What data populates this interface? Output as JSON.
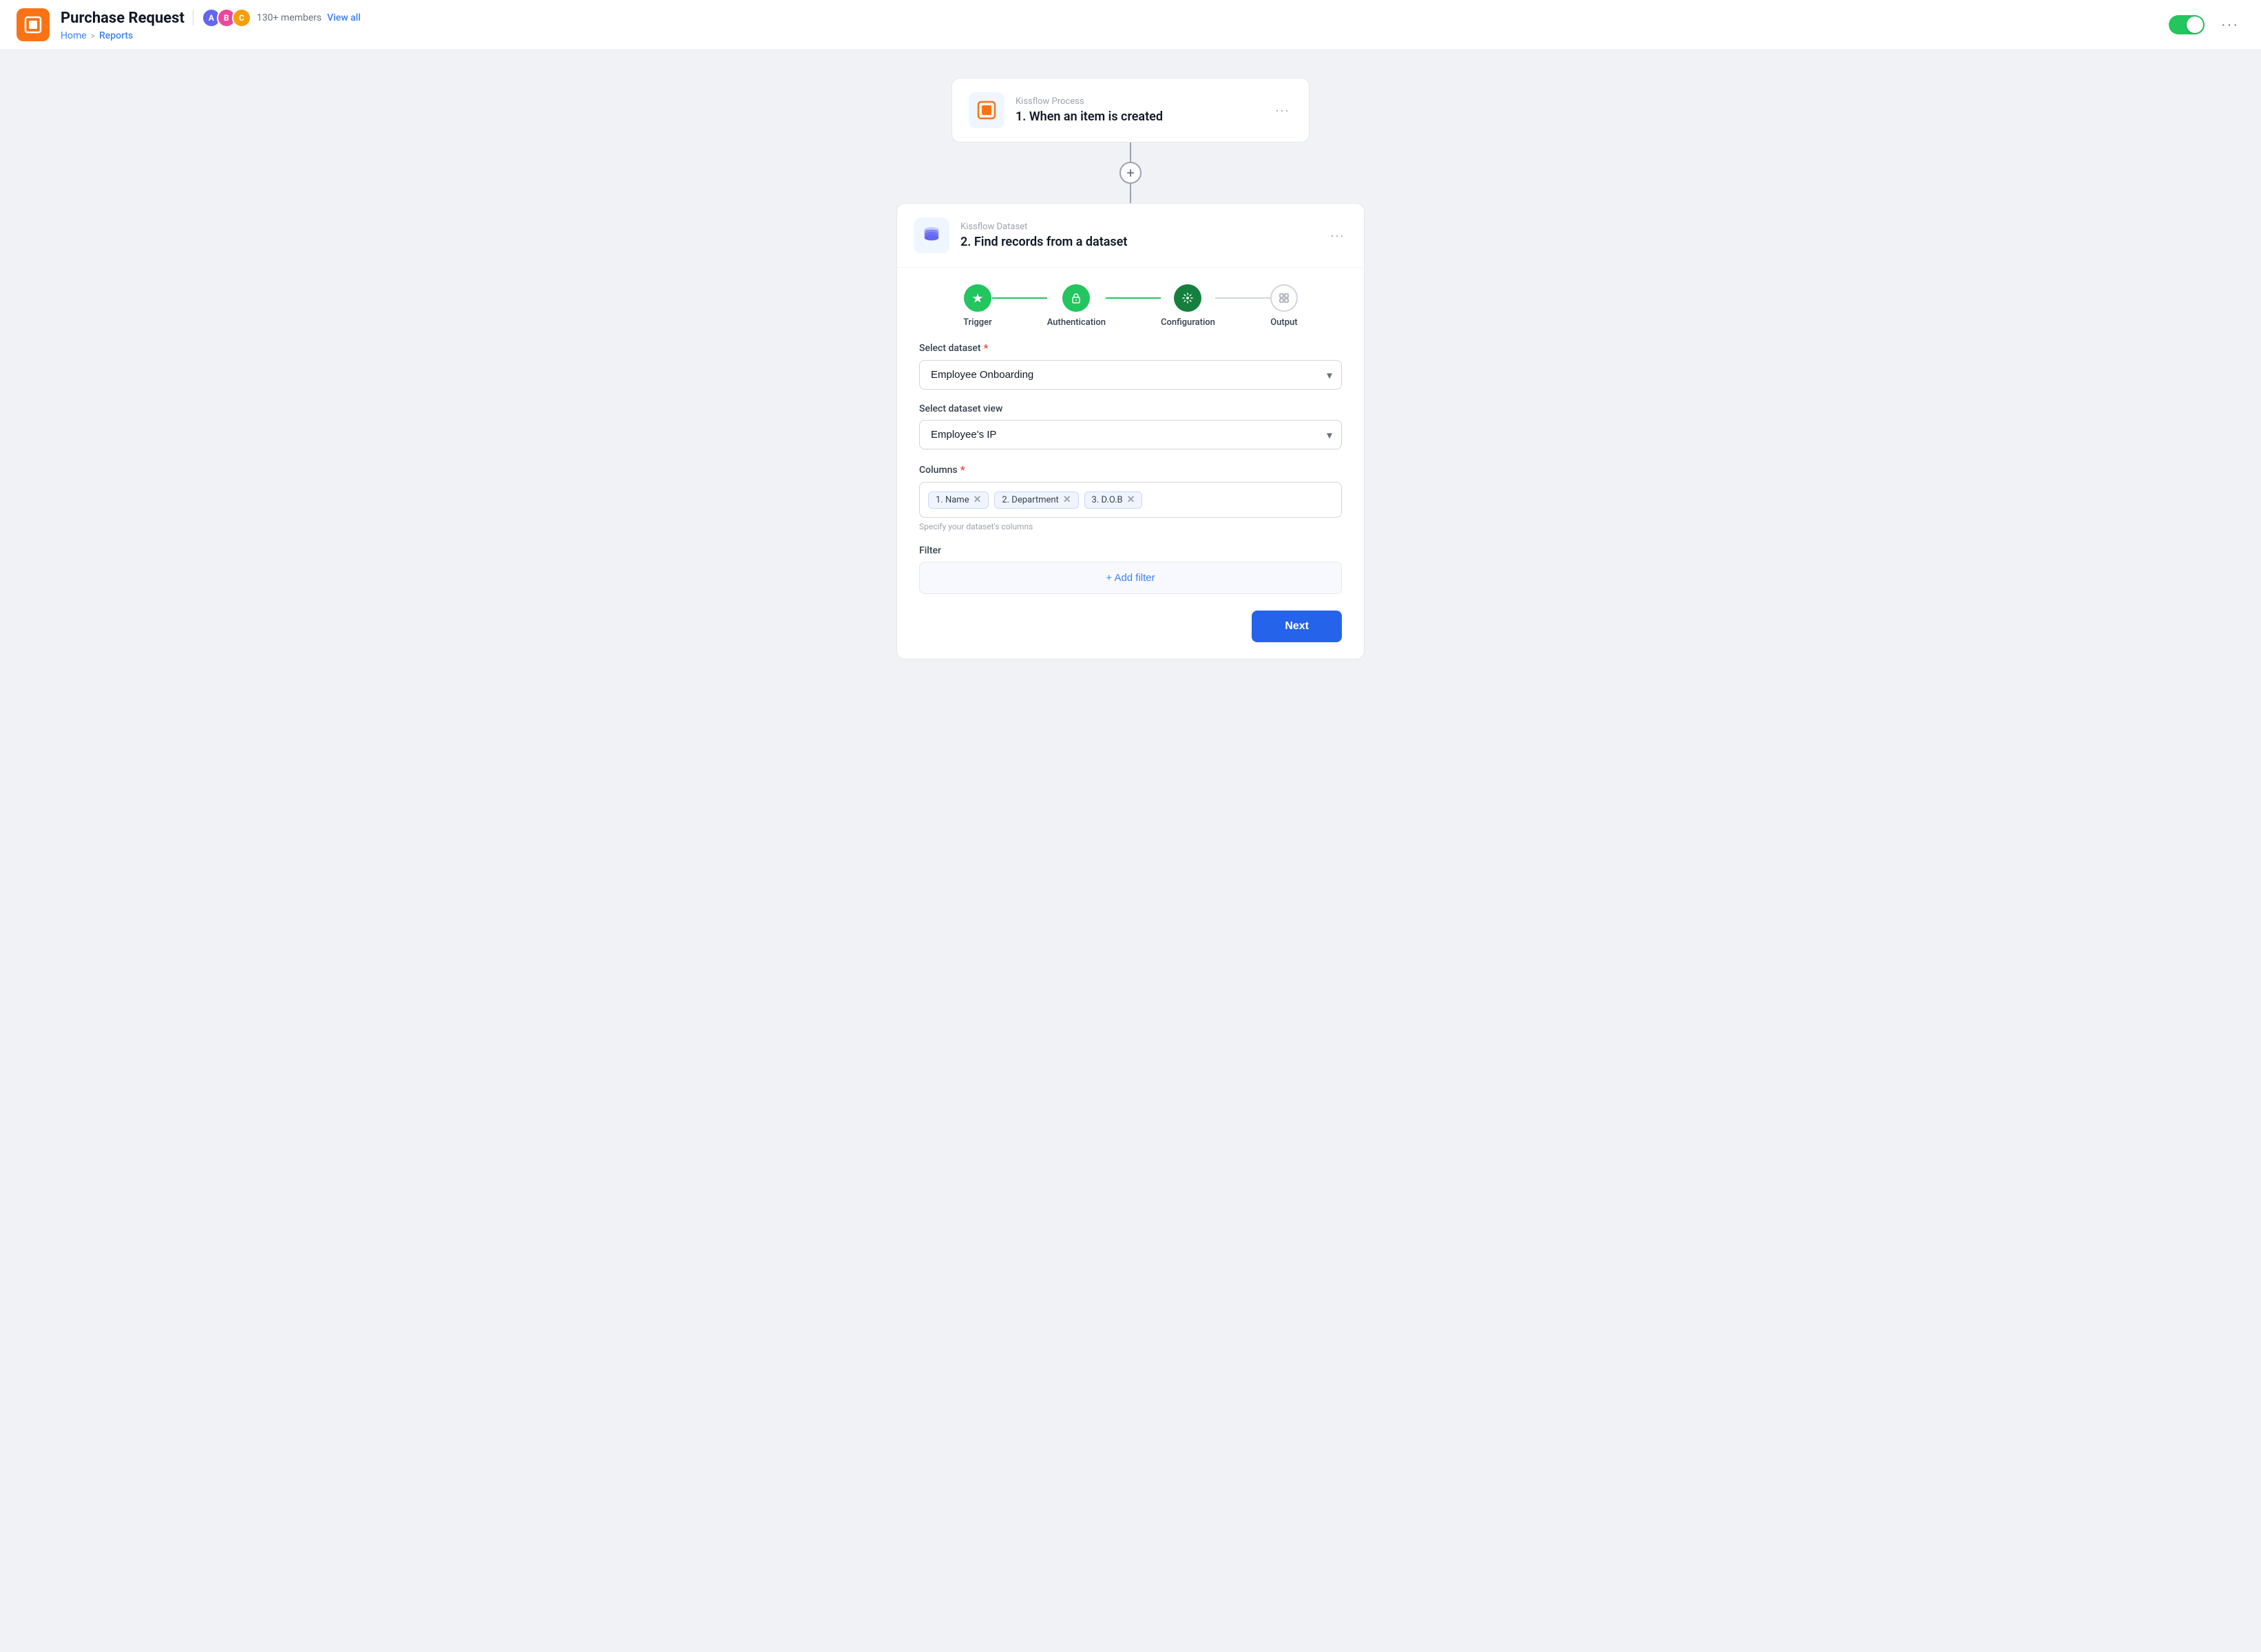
{
  "header": {
    "app_title": "Purchase Request",
    "members_count": "130+ members",
    "view_all_label": "View all",
    "breadcrumb_home": "Home",
    "breadcrumb_sep": ">",
    "breadcrumb_current": "Reports",
    "more_icon_label": "···"
  },
  "trigger_card": {
    "subtitle": "Kissflow Process",
    "title": "1. When an item is created",
    "menu_icon": "···"
  },
  "connector": {
    "plus_label": "+"
  },
  "dataset_card": {
    "header": {
      "subtitle": "Kissflow Dataset",
      "title": "2. Find records from a dataset",
      "menu_icon": "···"
    },
    "steps": [
      {
        "id": "trigger",
        "label": "Trigger",
        "state": "done"
      },
      {
        "id": "authentication",
        "label": "Authentication",
        "state": "done"
      },
      {
        "id": "configuration",
        "label": "Configuration",
        "state": "active"
      },
      {
        "id": "output",
        "label": "Output",
        "state": "inactive"
      }
    ],
    "form": {
      "dataset_label": "Select dataset",
      "dataset_required": true,
      "dataset_value": "Employee Onboarding",
      "dataset_options": [
        "Employee Onboarding"
      ],
      "view_label": "Select dataset view",
      "view_value": "Employee's IP",
      "view_options": [
        "Employee's IP"
      ],
      "columns_label": "Columns",
      "columns_required": true,
      "columns_tags": [
        {
          "id": "name",
          "label": "1. Name"
        },
        {
          "id": "department",
          "label": "2. Department"
        },
        {
          "id": "dob",
          "label": "3. D.O.B"
        }
      ],
      "columns_hint": "Specify your dataset's columns",
      "filter_label": "Filter",
      "add_filter_label": "+ Add filter",
      "next_label": "Next"
    }
  }
}
